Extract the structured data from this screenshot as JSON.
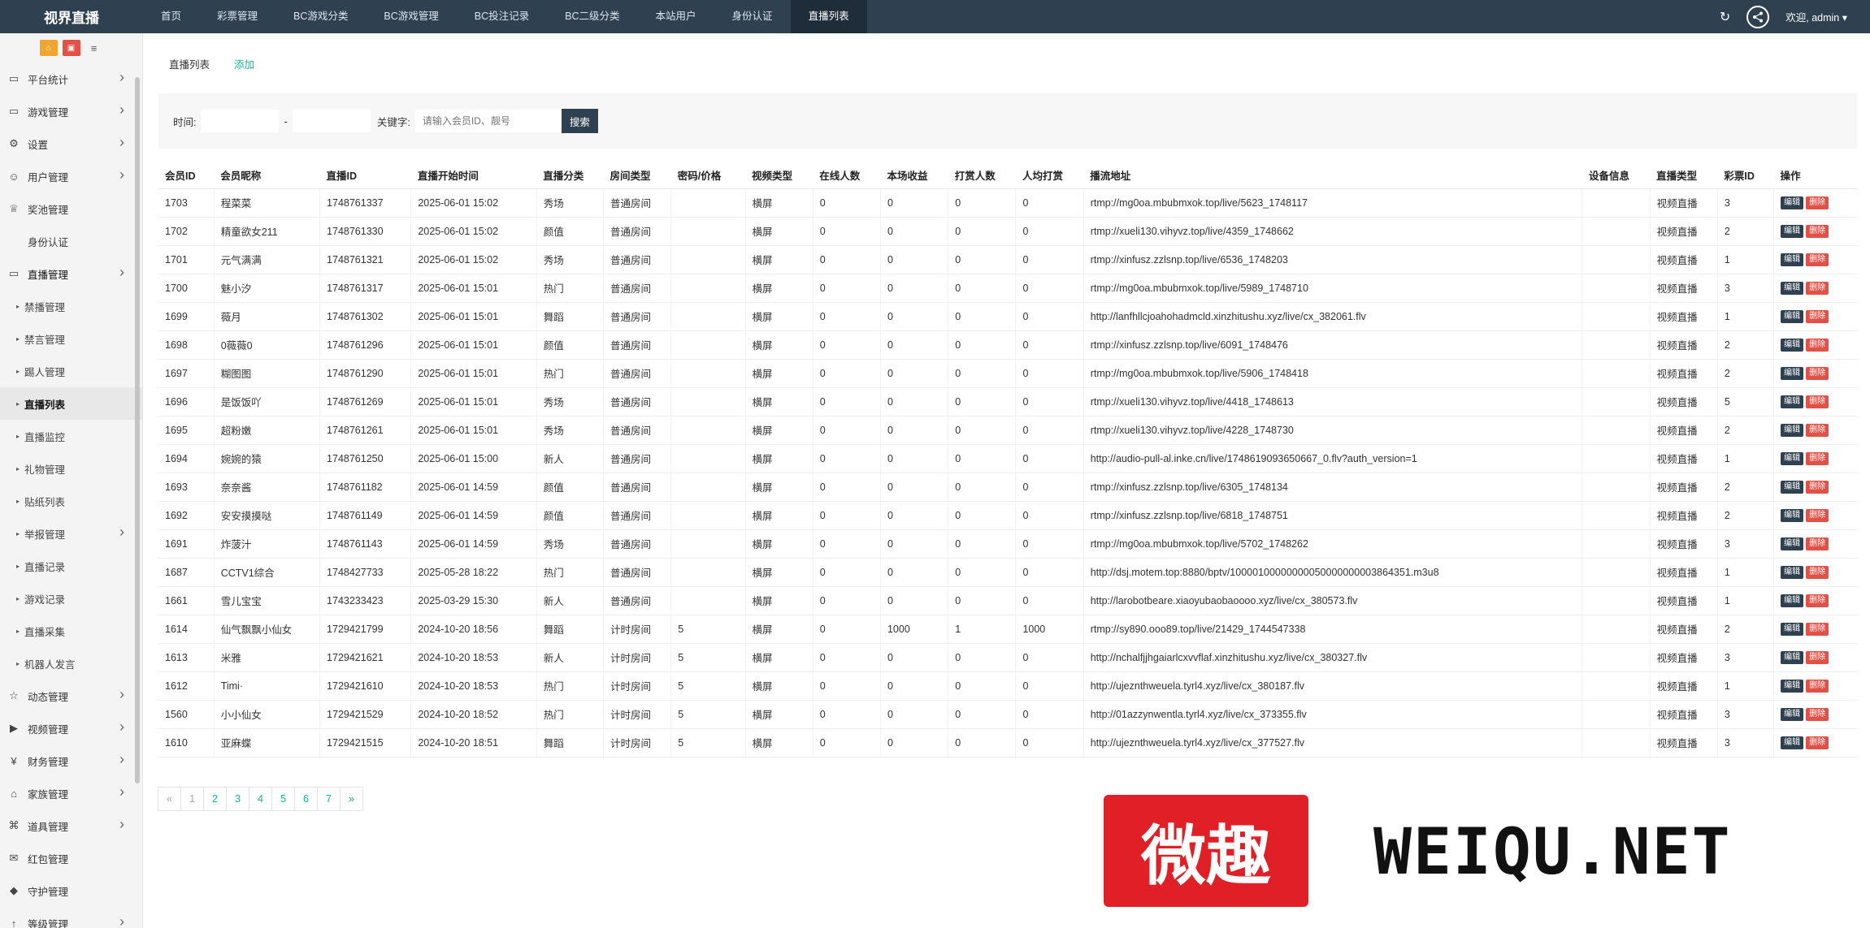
{
  "brand": "视界直播",
  "nav": [
    "首页",
    "彩票管理",
    "BC游戏分类",
    "BC游戏管理",
    "BC投注记录",
    "BC二级分类",
    "本站用户",
    "身份认证",
    "直播列表"
  ],
  "nav_active_index": 8,
  "welcome": "欢迎, admin ▾",
  "sidebar": [
    {
      "label": "平台统计",
      "icon": "monitor-icon",
      "chev": true
    },
    {
      "label": "游戏管理",
      "icon": "monitor-icon",
      "chev": true
    },
    {
      "label": "设置",
      "icon": "gears-icon",
      "chev": true
    },
    {
      "label": "用户管理",
      "icon": "users-icon",
      "chev": true
    },
    {
      "label": "奖池管理",
      "icon": "trophy-icon",
      "chev": false
    },
    {
      "label": "身份认证",
      "icon": "",
      "chev": false
    },
    {
      "label": "直播管理",
      "icon": "monitor-icon",
      "chev": true,
      "open": true
    },
    {
      "label": "禁播管理",
      "sub": true
    },
    {
      "label": "禁言管理",
      "sub": true
    },
    {
      "label": "踢人管理",
      "sub": true
    },
    {
      "label": "直播列表",
      "sub": true,
      "current": true
    },
    {
      "label": "直播监控",
      "sub": true
    },
    {
      "label": "礼物管理",
      "sub": true
    },
    {
      "label": "贴纸列表",
      "sub": true
    },
    {
      "label": "举报管理",
      "sub": true,
      "chev": true
    },
    {
      "label": "直播记录",
      "sub": true
    },
    {
      "label": "游戏记录",
      "sub": true
    },
    {
      "label": "直播采集",
      "sub": true
    },
    {
      "label": "机器人发言",
      "sub": true
    },
    {
      "label": "动态管理",
      "icon": "star-icon",
      "chev": true
    },
    {
      "label": "视频管理",
      "icon": "video-icon",
      "chev": true
    },
    {
      "label": "财务管理",
      "icon": "yen-icon",
      "chev": true
    },
    {
      "label": "家族管理",
      "icon": "bank-icon",
      "chev": true
    },
    {
      "label": "道具管理",
      "icon": "cart-icon",
      "chev": true
    },
    {
      "label": "红包管理",
      "icon": "envelope-icon",
      "chev": false
    },
    {
      "label": "守护管理",
      "icon": "shield-icon",
      "chev": false
    },
    {
      "label": "等级管理",
      "icon": "level-icon",
      "chev": true
    }
  ],
  "tabs": {
    "list": "直播列表",
    "add": "添加"
  },
  "filter": {
    "time_label": "时间:",
    "dash": "-",
    "keyword_label": "关键字:",
    "keyword_placeholder": "请输入会员ID、靓号",
    "search_btn": "搜索"
  },
  "table": {
    "columns": [
      "会员ID",
      "会员昵称",
      "直播ID",
      "直播开始时间",
      "直播分类",
      "房间类型",
      "密码/价格",
      "视频类型",
      "在线人数",
      "本场收益",
      "打赏人数",
      "人均打赏",
      "播流地址",
      "设备信息",
      "直播类型",
      "彩票ID",
      "操作"
    ],
    "edit_label": "编辑",
    "delete_label": "删除",
    "rows": [
      [
        "1703",
        "程菜菜",
        "1748761337",
        "2025-06-01 15:02",
        "秀场",
        "普通房间",
        "",
        "横屏",
        "0",
        "0",
        "0",
        "0",
        "rtmp://mg0oa.mbubmxok.top/live/5623_1748117",
        "",
        "视频直播",
        "3"
      ],
      [
        "1702",
        "精童欲女211",
        "1748761330",
        "2025-06-01 15:02",
        "颜值",
        "普通房间",
        "",
        "横屏",
        "0",
        "0",
        "0",
        "0",
        "rtmp://xueli130.vihyvz.top/live/4359_1748662",
        "",
        "视频直播",
        "2"
      ],
      [
        "1701",
        "元气满满",
        "1748761321",
        "2025-06-01 15:02",
        "秀场",
        "普通房间",
        "",
        "横屏",
        "0",
        "0",
        "0",
        "0",
        "rtmp://xinfusz.zzlsnp.top/live/6536_1748203",
        "",
        "视频直播",
        "1"
      ],
      [
        "1700",
        "魅小汐",
        "1748761317",
        "2025-06-01 15:01",
        "热门",
        "普通房间",
        "",
        "横屏",
        "0",
        "0",
        "0",
        "0",
        "rtmp://mg0oa.mbubmxok.top/live/5989_1748710",
        "",
        "视频直播",
        "3"
      ],
      [
        "1699",
        "薇月",
        "1748761302",
        "2025-06-01 15:01",
        "舞蹈",
        "普通房间",
        "",
        "横屏",
        "0",
        "0",
        "0",
        "0",
        "http://lanfhllcjoahohadmcld.xinzhitushu.xyz/live/cx_382061.flv",
        "",
        "视频直播",
        "1"
      ],
      [
        "1698",
        "0薇薇0",
        "1748761296",
        "2025-06-01 15:01",
        "颜值",
        "普通房间",
        "",
        "横屏",
        "0",
        "0",
        "0",
        "0",
        "rtmp://xinfusz.zzlsnp.top/live/6091_1748476",
        "",
        "视频直播",
        "2"
      ],
      [
        "1697",
        "糊图图",
        "1748761290",
        "2025-06-01 15:01",
        "热门",
        "普通房间",
        "",
        "横屏",
        "0",
        "0",
        "0",
        "0",
        "rtmp://mg0oa.mbubmxok.top/live/5906_1748418",
        "",
        "视频直播",
        "2"
      ],
      [
        "1696",
        "是饭饭吖",
        "1748761269",
        "2025-06-01 15:01",
        "秀场",
        "普通房间",
        "",
        "横屏",
        "0",
        "0",
        "0",
        "0",
        "rtmp://xueli130.vihyvz.top/live/4418_1748613",
        "",
        "视频直播",
        "5"
      ],
      [
        "1695",
        "超粉嫩",
        "1748761261",
        "2025-06-01 15:01",
        "秀场",
        "普通房间",
        "",
        "横屏",
        "0",
        "0",
        "0",
        "0",
        "rtmp://xueli130.vihyvz.top/live/4228_1748730",
        "",
        "视频直播",
        "2"
      ],
      [
        "1694",
        "婉婉的猿",
        "1748761250",
        "2025-06-01 15:00",
        "新人",
        "普通房间",
        "",
        "横屏",
        "0",
        "0",
        "0",
        "0",
        "http://audio-pull-al.inke.cn/live/1748619093650667_0.flv?auth_version=1",
        "",
        "视频直播",
        "1"
      ],
      [
        "1693",
        "奈奈酱",
        "1748761182",
        "2025-06-01 14:59",
        "颜值",
        "普通房间",
        "",
        "横屏",
        "0",
        "0",
        "0",
        "0",
        "rtmp://xinfusz.zzlsnp.top/live/6305_1748134",
        "",
        "视频直播",
        "2"
      ],
      [
        "1692",
        "安安摸摸哒",
        "1748761149",
        "2025-06-01 14:59",
        "颜值",
        "普通房间",
        "",
        "横屏",
        "0",
        "0",
        "0",
        "0",
        "rtmp://xinfusz.zzlsnp.top/live/6818_1748751",
        "",
        "视频直播",
        "2"
      ],
      [
        "1691",
        "炸菠汁",
        "1748761143",
        "2025-06-01 14:59",
        "秀场",
        "普通房间",
        "",
        "横屏",
        "0",
        "0",
        "0",
        "0",
        "rtmp://mg0oa.mbubmxok.top/live/5702_1748262",
        "",
        "视频直播",
        "3"
      ],
      [
        "1687",
        "CCTV1综合",
        "1748427733",
        "2025-05-28 18:22",
        "热门",
        "普通房间",
        "",
        "横屏",
        "0",
        "0",
        "0",
        "0",
        "http://dsj.motem.top:8880/bptv/10000100000000050000000003864351.m3u8",
        "",
        "视频直播",
        "1"
      ],
      [
        "1661",
        "雪儿宝宝",
        "1743233423",
        "2025-03-29 15:30",
        "新人",
        "普通房间",
        "",
        "横屏",
        "0",
        "0",
        "0",
        "0",
        "http://larobotbeare.xiaoyubaobaoooo.xyz/live/cx_380573.flv",
        "",
        "视频直播",
        "1"
      ],
      [
        "1614",
        "仙气飘飘小仙女",
        "1729421799",
        "2024-10-20 18:56",
        "舞蹈",
        "计时房间",
        "5",
        "横屏",
        "0",
        "1000",
        "1",
        "1000",
        "rtmp://sy890.ooo89.top/live/21429_1744547338",
        "",
        "视频直播",
        "2"
      ],
      [
        "1613",
        "米雅",
        "1729421621",
        "2024-10-20 18:53",
        "新人",
        "计时房间",
        "5",
        "横屏",
        "0",
        "0",
        "0",
        "0",
        "http://nchalfjjhgaiarlcxvvflaf.xinzhitushu.xyz/live/cx_380327.flv",
        "",
        "视频直播",
        "3"
      ],
      [
        "1612",
        "Timi·",
        "1729421610",
        "2024-10-20 18:53",
        "热门",
        "计时房间",
        "5",
        "横屏",
        "0",
        "0",
        "0",
        "0",
        "http://ujeznthweuela.tyrl4.xyz/live/cx_380187.flv",
        "",
        "视频直播",
        "1"
      ],
      [
        "1560",
        "小小仙女",
        "1729421529",
        "2024-10-20 18:52",
        "热门",
        "计时房间",
        "5",
        "横屏",
        "0",
        "0",
        "0",
        "0",
        "http://01azzynwentla.tyrl4.xyz/live/cx_373355.flv",
        "",
        "视频直播",
        "3"
      ],
      [
        "1610",
        "亚麻蝶",
        "1729421515",
        "2024-10-20 18:51",
        "舞蹈",
        "计时房间",
        "5",
        "横屏",
        "0",
        "0",
        "0",
        "0",
        "http://ujeznthweuela.tyrl4.xyz/live/cx_377527.flv",
        "",
        "视频直播",
        "3"
      ]
    ]
  },
  "pagination": [
    "«",
    "1",
    "2",
    "3",
    "4",
    "5",
    "6",
    "7",
    "»"
  ],
  "watermark": {
    "cn": "微趣",
    "en": "WEIQU.NET"
  }
}
